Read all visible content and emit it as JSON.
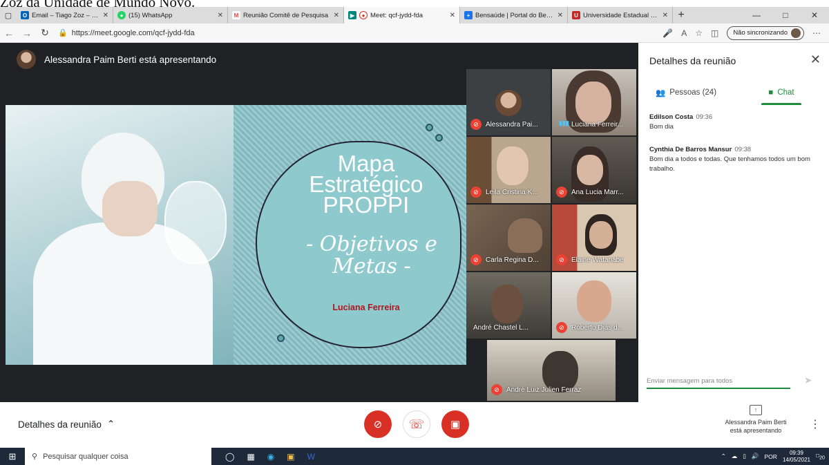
{
  "caption": "Zoz da Unidade de Mundo Novo.",
  "tabs": [
    {
      "label": "Email – Tiago Zoz – Outlook",
      "icon": "outlook-icon",
      "color": "#0364b8"
    },
    {
      "label": "(15) WhatsApp",
      "icon": "whatsapp-icon",
      "color": "#25d366"
    },
    {
      "label": "Reunião Comitê de Pesquisa",
      "icon": "gmail-icon",
      "color": "#ea4335"
    },
    {
      "label": "Meet: qcf-jydd-fda",
      "icon": "meet-icon",
      "color": "#00897b",
      "active": true
    },
    {
      "label": "Bensaúde | Portal do Benefi",
      "icon": "plus-icon",
      "color": "#1a73e8"
    },
    {
      "label": "Universidade Estadual de M",
      "icon": "university-icon",
      "color": "#c62828"
    }
  ],
  "address": {
    "url": "https://meet.google.com/qcf-jydd-fda",
    "sync_label": "Não sincronizando"
  },
  "meeting": {
    "presenter_banner": "Alessandra Paim Berti está apresentando",
    "slide": {
      "title_lines": [
        "Mapa",
        "Estratégico",
        "PROPPI"
      ],
      "subtitle_lines": [
        "- Objetivos e",
        "Metas -"
      ],
      "author": "Luciana Ferreira"
    },
    "participants": [
      {
        "name": "Alessandra Pai...",
        "muted": true
      },
      {
        "name": "Luciana Ferreir...",
        "muted": false
      },
      {
        "name": "Leila Cristina K...",
        "muted": true
      },
      {
        "name": "Ana Lucia Marr...",
        "muted": true
      },
      {
        "name": "Carla Regina D...",
        "muted": true
      },
      {
        "name": "Elaine Watanabe",
        "muted": true
      },
      {
        "name": "André Chastel L...",
        "muted": false
      },
      {
        "name": "Roberto Dias d...",
        "muted": true
      },
      {
        "name": "André Luiz Julien Ferraz",
        "muted": true
      }
    ]
  },
  "panel": {
    "title": "Detalhes da reunião",
    "people_tab": "Pessoas (24)",
    "chat_tab": "Chat",
    "messages": [
      {
        "sender": "Edilson Costa",
        "time": "09:36",
        "text": "Bom dia"
      },
      {
        "sender": "Cynthia De Barros Mansur",
        "time": "09:38",
        "text": "Bom dia a todos e todas. Que tenhamos todos um bom trabalho."
      }
    ],
    "compose_placeholder": "Enviar mensagem para todos"
  },
  "bottom": {
    "details_label": "Detalhes da reunião",
    "presenting_line1": "Alessandra Paim Berti",
    "presenting_line2": "está apresentando"
  },
  "taskbar": {
    "search_placeholder": "Pesquisar qualquer coisa",
    "language": "POR",
    "time": "09:39",
    "date": "14/05/2021",
    "notification_count": "20"
  },
  "colors": {
    "meet_bg": "#202124",
    "danger": "#d93025",
    "accent": "#1e8e3e"
  }
}
